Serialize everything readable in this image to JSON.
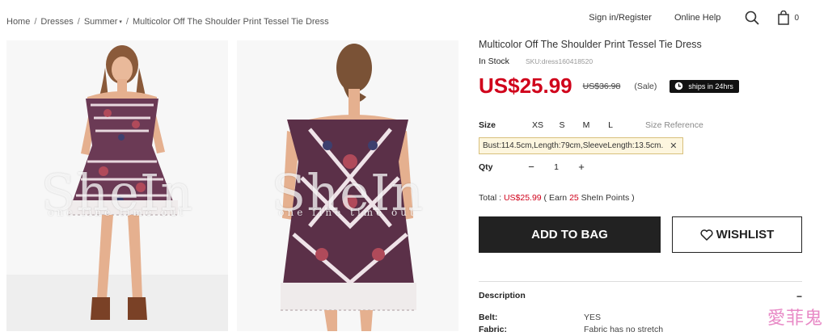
{
  "breadcrumb": {
    "items": [
      "Home",
      "Dresses",
      "Summer",
      "Multicolor Off The Shoulder Print Tessel Tie Dress"
    ],
    "separator": "/"
  },
  "topnav": {
    "signin": "Sign in/Register",
    "help": "Online Help",
    "search_icon": "search-icon",
    "bag_icon": "shopping-bag-icon",
    "bag_count": "0"
  },
  "images": {
    "watermark": "SheIn",
    "watermark_sub": "one fine time out"
  },
  "product": {
    "title": "Multicolor Off The Shoulder Print Tessel Tie Dress",
    "stock": "In Stock",
    "sku": "SKU:dress160418520",
    "price": "US$25.99",
    "old_price": "US$36.98",
    "sale": "(Sale)",
    "ship_badge": "ships in 24hrs",
    "price_color": "#d0021b"
  },
  "size": {
    "label": "Size",
    "options": [
      "XS",
      "S",
      "M",
      "L"
    ],
    "reference": "Size Reference",
    "fit_info": "Bust:114.5cm,Length:79cm,SleeveLength:13.5cm."
  },
  "qty": {
    "label": "Qty",
    "minus": "−",
    "value": "1",
    "plus": "+"
  },
  "total": {
    "prefix": "Total : ",
    "amount": "US$25.99",
    "earn_open": " ( Earn ",
    "points": "25",
    "earn_close": " SheIn Points )"
  },
  "buttons": {
    "add_to_bag": "ADD TO BAG",
    "wishlist": "WISHLIST"
  },
  "description": {
    "heading": "Description",
    "toggle": "−",
    "specs": [
      {
        "key": "Belt:",
        "value": "YES"
      },
      {
        "key": "Fabric:",
        "value": "Fabric has no stretch"
      }
    ]
  },
  "corner_watermark": "愛菲鬼"
}
